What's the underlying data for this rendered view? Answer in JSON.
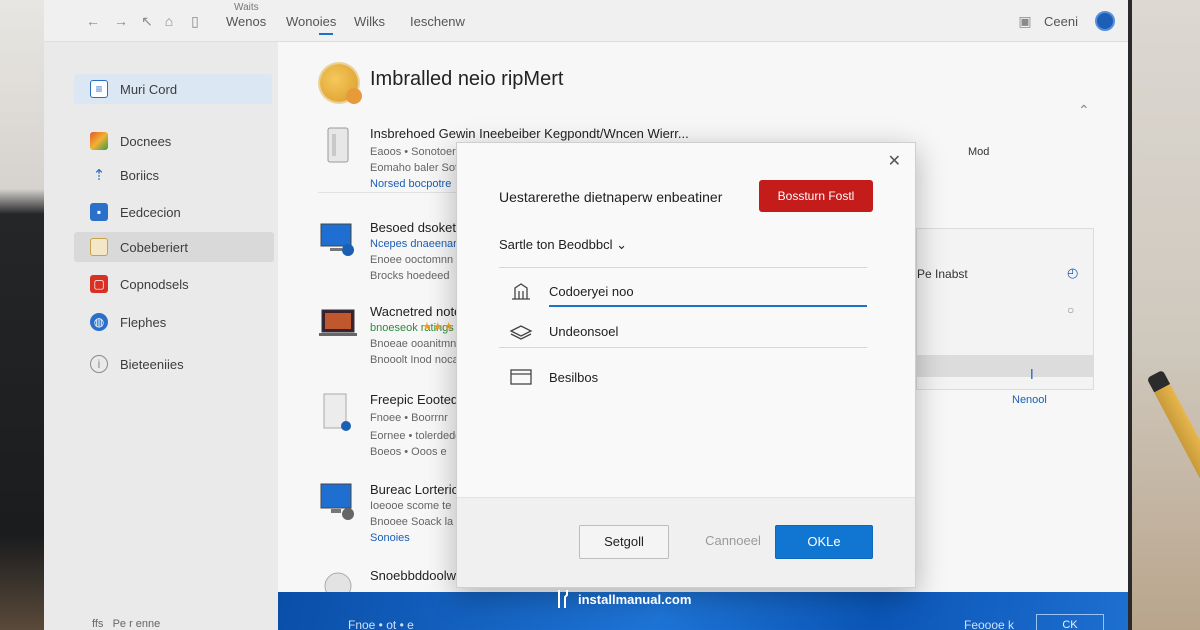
{
  "topbar": {
    "small_label": "Waits",
    "tabs": [
      "Wenos",
      "Wonoies",
      "Wilks",
      "Ieschenw"
    ],
    "right_label": "Ceeni"
  },
  "sidebar": {
    "items": [
      {
        "label": "Muri Cord",
        "icon": "document-icon",
        "color": "#2a6fc9"
      },
      {
        "label": "Docnees",
        "icon": "colorful-badge-icon",
        "color": "#e05a2b"
      },
      {
        "label": "Boriics",
        "icon": "up-arrow-icon",
        "color": "#2a6fc9"
      },
      {
        "label": "Eedcecion",
        "icon": "blue-square-icon",
        "color": "#2a6fc9"
      },
      {
        "label": "Cobeberiert",
        "icon": "box-icon",
        "color": "#c9a24a"
      },
      {
        "label": "Copnodsels",
        "icon": "red-app-icon",
        "color": "#d93025"
      },
      {
        "label": "Flephes",
        "icon": "globe-icon",
        "color": "#2a6fc9"
      },
      {
        "label": "Bieteeniies",
        "icon": "info-icon",
        "color": "#8a8a8a"
      }
    ],
    "footer": "ffs   Pe r enne"
  },
  "main": {
    "title": "Imbralled neio ripMert",
    "rows": [
      {
        "title": "Insbrehoed Gewin Ineebeiber Kegpondt/Wncen Wierr...",
        "subs": [
          "Eaoos • Sonotoer",
          "Eomaho baler Soteeemnot",
          "Norsed bocpotre"
        ],
        "sub_classes": [
          "",
          "",
          "blue"
        ],
        "icon": "tower-pc-icon"
      },
      {
        "title": "Besoed dsoketo",
        "subs": [
          "Ncepes dnaeenar",
          "Enoee ooctomnn",
          "Brocks hoedeed"
        ],
        "sub_classes": [
          "blue",
          "",
          ""
        ],
        "icon": "monitor-icon"
      },
      {
        "title": "Wacnetred notecd",
        "subs": [
          "bnoeseok ratings",
          "Bnoeae ooanitmn",
          "Bnooolt Inod noca"
        ],
        "sub_classes": [
          "green",
          "",
          ""
        ],
        "icon": "laptop-icon"
      },
      {
        "title": "Freepic Eootedtr",
        "subs": [
          "Fnoee • Boorrnr",
          "Eornee • tolerdedee",
          "Boeos • Ooos e"
        ],
        "sub_classes": [
          "",
          "",
          ""
        ],
        "icon": "server-icon"
      },
      {
        "title": "Bureac Lorterior",
        "subs": [
          "Ioeooe scome te",
          "Bnooee Soack la",
          "Sonoies"
        ],
        "sub_classes": [
          "",
          "",
          "blue"
        ],
        "icon": "desktop-icon"
      },
      {
        "title": "Snoebbddoolw",
        "subs": [],
        "sub_classes": [],
        "icon": "drive-icon"
      }
    ],
    "right_panel": {
      "top_label": "Mod",
      "field": "Pe Inabst",
      "link": "Nenool"
    },
    "bottom_band": {
      "left": "Fnoe • ot • e",
      "right": "Feoooe k"
    },
    "bottom_button": "CK"
  },
  "dialog": {
    "question": "Uestarerethe dietnaperw enbeatiner",
    "red_button": "Bossturn Fostl",
    "dropdown": "Sartle ton Beodbbcl",
    "options": [
      {
        "label": "Codoeryei noo",
        "icon": "building-icon"
      },
      {
        "label": "Undeonsoel",
        "icon": "stack-icon"
      },
      {
        "label": "Besilbos",
        "icon": "window-icon"
      }
    ],
    "buttons": {
      "secondary": "Setgoll",
      "ghost": "Cannoeel",
      "primary": "OKLe"
    }
  },
  "watermark": "installmanual.com"
}
